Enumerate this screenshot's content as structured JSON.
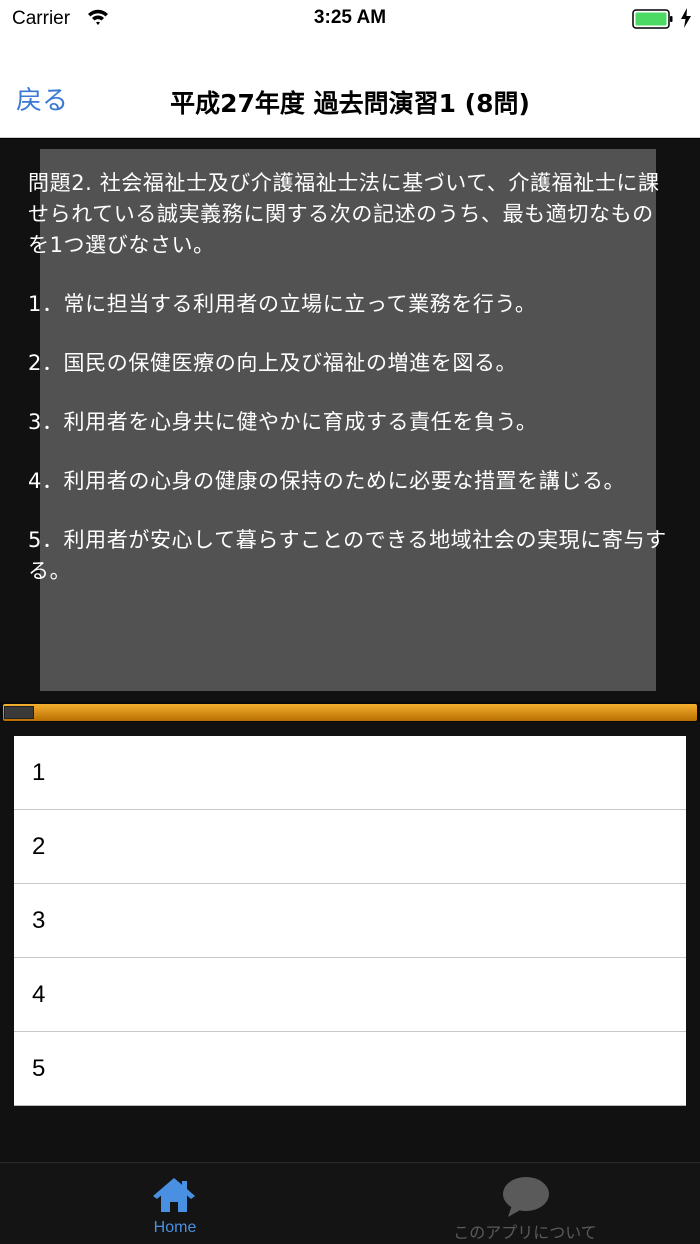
{
  "status_bar": {
    "carrier": "Carrier",
    "time": "3:25 AM",
    "battery_color": "#4cd964"
  },
  "nav": {
    "back_label": "戻る",
    "title": "平成27年度 過去問演習1 (8問)"
  },
  "question": {
    "stem": "問題2. 社会福祉士及び介護福祉士法に基づいて、介護福祉士に課せられている誠実義務に関する次の記述のうち、最も適切なものを1つ選びなさい。",
    "choices": [
      "1．常に担当する利用者の立場に立って業務を行う。",
      "2．国民の保健医療の向上及び福祉の増進を図る。",
      "3．利用者を心身共に健やかに育成する責任を負う。",
      "4．利用者の心身の健康の保持のために必要な措置を講じる。",
      "5．利用者が安心して暮らすことのできる地域社会の実現に寄与する。"
    ]
  },
  "answers": [
    "1",
    "2",
    "3",
    "4",
    "5"
  ],
  "tab_bar": {
    "home_label": "Home",
    "home_icon": "home-icon",
    "about_label": "このアプリについて",
    "about_icon": "speech-bubble-icon",
    "active_color": "#4a90e2",
    "inactive_color": "#5a5a5a"
  }
}
